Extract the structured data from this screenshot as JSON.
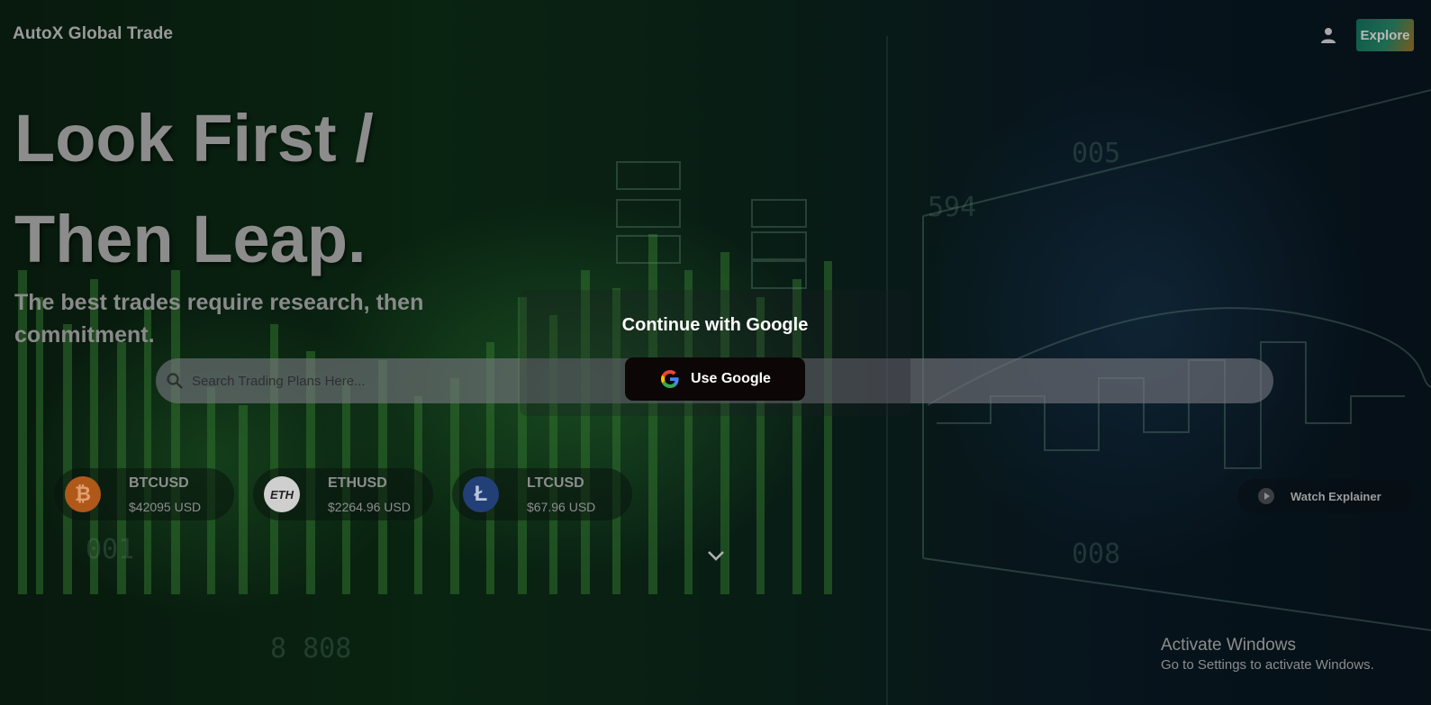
{
  "brand": {
    "name": "AutoX Global Trade"
  },
  "header": {
    "explore_label": "Explore",
    "user_icon": "user-icon"
  },
  "hero": {
    "title_line1": "Look First /",
    "title_line2": "Then Leap.",
    "subtitle": "The best trades require research, then commitment."
  },
  "search": {
    "placeholder": "Search Trading Plans Here...",
    "icon": "search-icon"
  },
  "tickers": [
    {
      "symbol": "BTCUSD",
      "price": "$42095 USD",
      "coin_glyph": "₿",
      "color": "#c2611d"
    },
    {
      "symbol": "ETHUSD",
      "price": "$2264.96 USD",
      "coin_glyph": "ETH",
      "color": "#d9d9d9"
    },
    {
      "symbol": "LTCUSD",
      "price": "$67.96 USD",
      "coin_glyph": "Ł",
      "color": "#2a4a8a"
    }
  ],
  "watch": {
    "label": "Watch Explainer",
    "icon": "play-icon"
  },
  "scroll": {
    "icon": "chevron-down-icon"
  },
  "modal": {
    "title": "Continue with Google",
    "button_label": "Use Google",
    "icon": "google-icon"
  },
  "os_notice": {
    "line1": "Activate Windows",
    "line2": "Go to Settings to activate Windows."
  }
}
